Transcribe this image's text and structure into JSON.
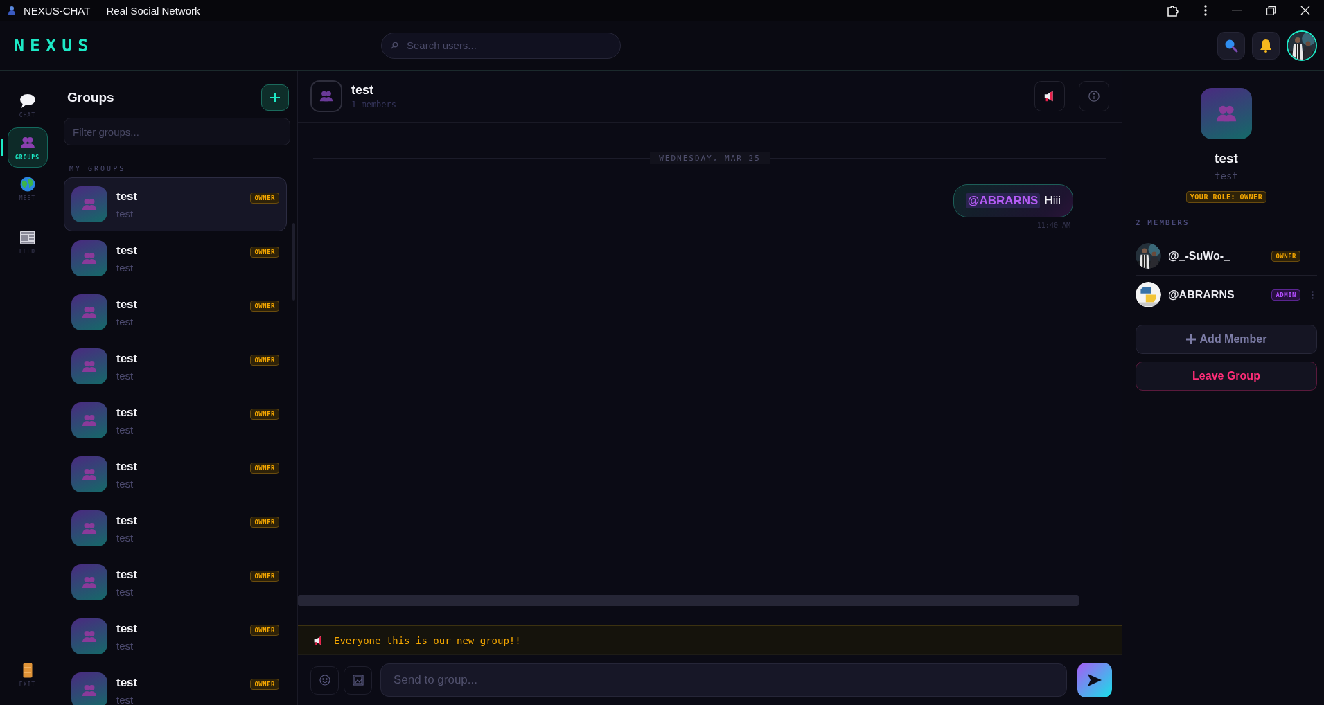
{
  "window": {
    "title": "NEXUS-CHAT — Real Social Network"
  },
  "header": {
    "logo": "NEXUS",
    "search": {
      "placeholder": "Search users..."
    }
  },
  "nav": [
    {
      "label": "CHAT",
      "kind": "chat",
      "selected": false
    },
    {
      "label": "GROUPS",
      "kind": "groups",
      "selected": true
    },
    {
      "label": "MEET",
      "kind": "meet",
      "selected": false
    },
    {
      "label": "FEED",
      "kind": "feed",
      "selected": false
    }
  ],
  "exit_button": {
    "label": "EXIT"
  },
  "groups_panel": {
    "title": "Groups",
    "filter": {
      "placeholder": "Filter groups..."
    },
    "section": "MY GROUPS",
    "groups": [
      {
        "name": "test",
        "subtitle": "test",
        "role": "OWNER",
        "selected": true
      },
      {
        "name": "test",
        "subtitle": "test",
        "role": "OWNER",
        "selected": false
      },
      {
        "name": "test",
        "subtitle": "test",
        "role": "OWNER",
        "selected": false
      },
      {
        "name": "test",
        "subtitle": "test",
        "role": "OWNER",
        "selected": false
      },
      {
        "name": "test",
        "subtitle": "test",
        "role": "OWNER",
        "selected": false
      },
      {
        "name": "test",
        "subtitle": "test",
        "role": "OWNER",
        "selected": false
      },
      {
        "name": "test",
        "subtitle": "test",
        "role": "OWNER",
        "selected": false
      },
      {
        "name": "test",
        "subtitle": "test",
        "role": "OWNER",
        "selected": false
      },
      {
        "name": "test",
        "subtitle": "test",
        "role": "OWNER",
        "selected": false
      },
      {
        "name": "test",
        "subtitle": "test",
        "role": "OWNER",
        "selected": false
      }
    ]
  },
  "chat": {
    "name": "test",
    "members": "1 members",
    "date": "WEDNESDAY, MAR 25",
    "messages": [
      {
        "mention": "@ABRARNS",
        "text": "Hiii",
        "time": "11:40 AM",
        "outgoing": true
      }
    ],
    "announcement": "Everyone this is our new group!!",
    "composer": {
      "placeholder": "Send to group..."
    }
  },
  "info_panel": {
    "name": "test",
    "description": "test",
    "role_badge": "YOUR ROLE: OWNER",
    "members_heading": "2 MEMBERS",
    "members": [
      {
        "name": "@_-SuWo-_",
        "role": "OWNER",
        "kind": "owner",
        "menu": false
      },
      {
        "name": "@ABRARNS",
        "role": "ADMIN",
        "kind": "admin",
        "menu": true
      }
    ],
    "add_button": "Add Member",
    "leave_button": "Leave Group"
  }
}
